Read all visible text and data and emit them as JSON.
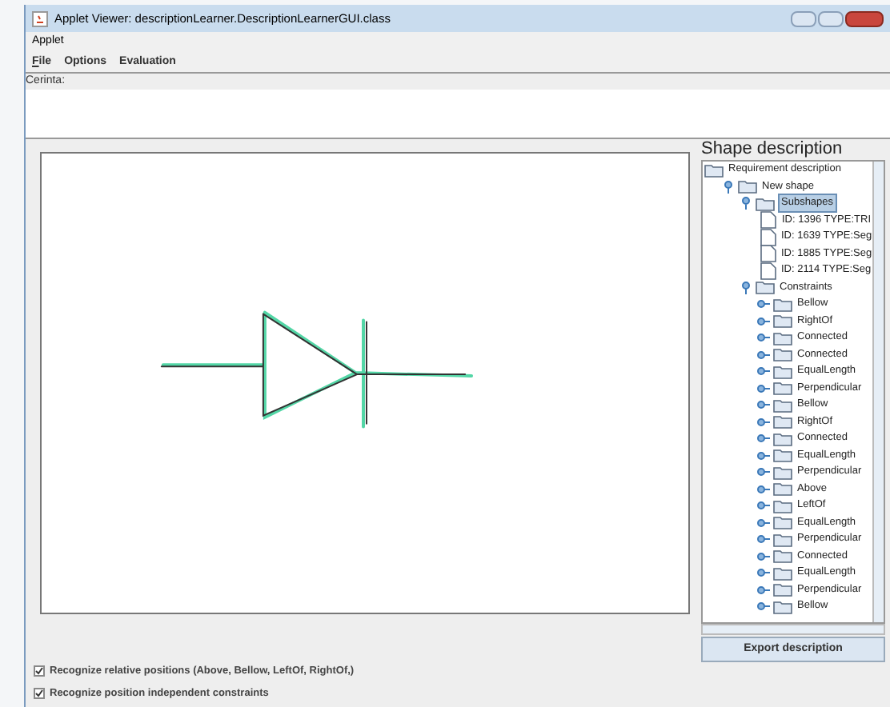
{
  "window": {
    "title": "Applet Viewer: descriptionLearner.DescriptionLearnerGUI.class"
  },
  "applet_menu": [
    "Applet"
  ],
  "menu_bar": [
    {
      "label": "File",
      "mnemonic": true
    },
    {
      "label": "Options",
      "mnemonic": false
    },
    {
      "label": "Evaluation",
      "mnemonic": false
    }
  ],
  "cerinta": {
    "label": "Cerinta:"
  },
  "canvas": {
    "kind": "sketch"
  },
  "shape_description": {
    "title": "Shape description",
    "tree": [
      {
        "label": "Requirement description",
        "kind": "root",
        "selected": false,
        "children": [
          {
            "label": "New shape",
            "kind": "folder",
            "expanded": true,
            "selected": false,
            "children": [
              {
                "label": "Subshapes",
                "kind": "folder",
                "expanded": true,
                "selected": true,
                "children": [
                  {
                    "label": "ID: 1396 TYPE:TRI",
                    "kind": "leaf",
                    "selected": false
                  },
                  {
                    "label": "ID: 1639 TYPE:Seg",
                    "kind": "leaf",
                    "selected": false
                  },
                  {
                    "label": "ID: 1885 TYPE:Seg",
                    "kind": "leaf",
                    "selected": false
                  },
                  {
                    "label": "ID: 2114 TYPE:Seg",
                    "kind": "leaf",
                    "selected": false
                  }
                ]
              },
              {
                "label": "Constraints",
                "kind": "folder",
                "expanded": true,
                "selected": false,
                "children": [
                  {
                    "label": "Bellow",
                    "kind": "folder",
                    "expanded": false,
                    "selected": false
                  },
                  {
                    "label": "RightOf",
                    "kind": "folder",
                    "expanded": false,
                    "selected": false
                  },
                  {
                    "label": "Connected",
                    "kind": "folder",
                    "expanded": false,
                    "selected": false
                  },
                  {
                    "label": "Connected",
                    "kind": "folder",
                    "expanded": false,
                    "selected": false
                  },
                  {
                    "label": "EqualLength",
                    "kind": "folder",
                    "expanded": false,
                    "selected": false
                  },
                  {
                    "label": "Perpendicular",
                    "kind": "folder",
                    "expanded": false,
                    "selected": false
                  },
                  {
                    "label": "Bellow",
                    "kind": "folder",
                    "expanded": false,
                    "selected": false
                  },
                  {
                    "label": "RightOf",
                    "kind": "folder",
                    "expanded": false,
                    "selected": false
                  },
                  {
                    "label": "Connected",
                    "kind": "folder",
                    "expanded": false,
                    "selected": false
                  },
                  {
                    "label": "EqualLength",
                    "kind": "folder",
                    "expanded": false,
                    "selected": false
                  },
                  {
                    "label": "Perpendicular",
                    "kind": "folder",
                    "expanded": false,
                    "selected": false
                  },
                  {
                    "label": "Above",
                    "kind": "folder",
                    "expanded": false,
                    "selected": false
                  },
                  {
                    "label": "LeftOf",
                    "kind": "folder",
                    "expanded": false,
                    "selected": false
                  },
                  {
                    "label": "EqualLength",
                    "kind": "folder",
                    "expanded": false,
                    "selected": false
                  },
                  {
                    "label": "Perpendicular",
                    "kind": "folder",
                    "expanded": false,
                    "selected": false
                  },
                  {
                    "label": "Connected",
                    "kind": "folder",
                    "expanded": false,
                    "selected": false
                  },
                  {
                    "label": "EqualLength",
                    "kind": "folder",
                    "expanded": false,
                    "selected": false
                  },
                  {
                    "label": "Perpendicular",
                    "kind": "folder",
                    "expanded": false,
                    "selected": false
                  },
                  {
                    "label": "Bellow",
                    "kind": "folder",
                    "expanded": false,
                    "selected": false
                  }
                ]
              }
            ]
          }
        ]
      }
    ],
    "export_button": "Export description"
  },
  "options": [
    {
      "label": "Recognize relative positions (Above, Bellow, LeftOf, RightOf,)",
      "checked": true
    },
    {
      "label": "Recognize position independent constraints",
      "checked": true
    }
  ]
}
